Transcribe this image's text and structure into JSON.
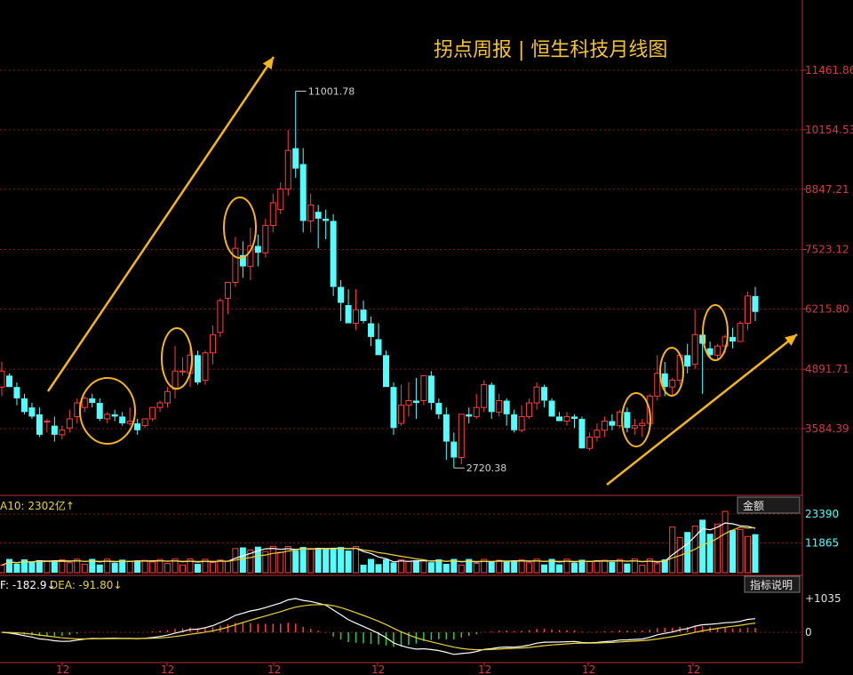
{
  "title": "拐点周报 | 恒生科技月线图",
  "chart_data": {
    "type": "candlestick",
    "y_ticks": [
      "11461.86",
      "10154.53",
      "8847.21",
      "7523.12",
      "6215.80",
      "4891.71",
      "3584.39"
    ],
    "x_ticks": [
      "12",
      "12",
      "12",
      "12",
      "12",
      "12",
      "12"
    ],
    "max_label": "11001.78",
    "min_label": "2720.38",
    "ohlc": [
      [
        4500,
        5050,
        4300,
        4850
      ],
      [
        4750,
        4800,
        4500,
        4500
      ],
      [
        4500,
        4600,
        4100,
        4250
      ],
      [
        4250,
        4350,
        3900,
        3950
      ],
      [
        4050,
        4150,
        3800,
        3850
      ],
      [
        3900,
        4050,
        3400,
        3450
      ],
      [
        3750,
        3800,
        3500,
        3750
      ],
      [
        3650,
        3850,
        3300,
        3450
      ],
      [
        3450,
        3650,
        3350,
        3550
      ],
      [
        3600,
        4000,
        3500,
        3800
      ],
      [
        3850,
        4250,
        3700,
        4150
      ],
      [
        4050,
        4300,
        3950,
        4250
      ],
      [
        4250,
        4350,
        4050,
        4150
      ],
      [
        4150,
        4250,
        3750,
        3800
      ],
      [
        3800,
        3950,
        3700,
        3900
      ],
      [
        3900,
        4000,
        3750,
        3850
      ],
      [
        3850,
        3950,
        3650,
        3700
      ],
      [
        3700,
        4050,
        3650,
        3750
      ],
      [
        3700,
        3800,
        3450,
        3550
      ],
      [
        3650,
        3800,
        3600,
        3800
      ],
      [
        3800,
        4050,
        3750,
        4050
      ],
      [
        4050,
        4200,
        3950,
        4150
      ],
      [
        4150,
        4500,
        4050,
        4400
      ],
      [
        4450,
        5400,
        4250,
        4850
      ],
      [
        4850,
        5150,
        4750,
        4850
      ],
      [
        4800,
        5400,
        4500,
        5200
      ],
      [
        5200,
        5300,
        4550,
        4600
      ],
      [
        4650,
        5300,
        4550,
        5250
      ],
      [
        5250,
        5850,
        5000,
        5650
      ],
      [
        5700,
        6450,
        5600,
        6400
      ],
      [
        6450,
        6750,
        6100,
        6800
      ],
      [
        6800,
        7800,
        6700,
        7550
      ],
      [
        7400,
        7700,
        6900,
        7150
      ],
      [
        7150,
        8000,
        6850,
        7600
      ],
      [
        7600,
        7850,
        7150,
        7450
      ],
      [
        7450,
        8200,
        7350,
        8050
      ],
      [
        8050,
        8750,
        7900,
        8550
      ],
      [
        8400,
        9000,
        8300,
        8850
      ],
      [
        8850,
        10150,
        8700,
        9700
      ],
      [
        9750,
        11001.78,
        9100,
        9300
      ],
      [
        9400,
        9750,
        7900,
        8150
      ],
      [
        8150,
        8750,
        7900,
        8500
      ],
      [
        8350,
        8500,
        7550,
        8200
      ],
      [
        8200,
        8400,
        7750,
        8150
      ],
      [
        8150,
        8300,
        6500,
        6700
      ],
      [
        6700,
        6850,
        5950,
        6350
      ],
      [
        6300,
        6650,
        5900,
        5900
      ],
      [
        5900,
        6650,
        5750,
        6200
      ],
      [
        6200,
        6400,
        5900,
        5950
      ],
      [
        5900,
        6050,
        5400,
        5600
      ],
      [
        5550,
        5900,
        5200,
        5200
      ],
      [
        5200,
        5300,
        4800,
        4500
      ],
      [
        4500,
        4600,
        3450,
        3600
      ],
      [
        3700,
        4550,
        3650,
        4100
      ],
      [
        4100,
        4600,
        3850,
        4200
      ],
      [
        4200,
        4700,
        3800,
        4150
      ],
      [
        4200,
        4750,
        4100,
        4750
      ],
      [
        4750,
        4850,
        4000,
        4150
      ],
      [
        4150,
        4250,
        3800,
        3900
      ],
      [
        3900,
        4050,
        2900,
        3300
      ],
      [
        3300,
        3500,
        2720.38,
        2950
      ],
      [
        2950,
        3900,
        2800,
        3900
      ],
      [
        3900,
        4050,
        3700,
        3850
      ],
      [
        3850,
        4350,
        3800,
        4050
      ],
      [
        4050,
        4650,
        3950,
        4550
      ],
      [
        4550,
        4600,
        3800,
        3950
      ],
      [
        3950,
        4350,
        3850,
        4200
      ],
      [
        4200,
        4250,
        3650,
        3900
      ],
      [
        3900,
        4000,
        3500,
        3550
      ],
      [
        3550,
        4100,
        3500,
        3850
      ],
      [
        3850,
        4250,
        3800,
        4150
      ],
      [
        4150,
        4600,
        4000,
        4500
      ],
      [
        4500,
        4550,
        4050,
        4200
      ],
      [
        4200,
        4250,
        3850,
        3850
      ],
      [
        3850,
        3950,
        3750,
        3750
      ],
      [
        3750,
        3950,
        3650,
        3850
      ],
      [
        3850,
        3900,
        3600,
        3800
      ],
      [
        3800,
        3850,
        3150,
        3150
      ],
      [
        3150,
        3500,
        3100,
        3400
      ],
      [
        3400,
        3700,
        3300,
        3550
      ],
      [
        3550,
        3850,
        3400,
        3750
      ],
      [
        3750,
        3900,
        3550,
        3650
      ],
      [
        3650,
        4000,
        3600,
        3950
      ],
      [
        3950,
        4050,
        3500,
        3600
      ],
      [
        3600,
        3800,
        3450,
        3650
      ],
      [
        3650,
        3800,
        3400,
        3700
      ],
      [
        3700,
        4350,
        3650,
        4300
      ],
      [
        4300,
        5200,
        4200,
        4800
      ],
      [
        4800,
        5050,
        4300,
        4500
      ],
      [
        4500,
        4700,
        4300,
        4650
      ],
      [
        4650,
        5250,
        4550,
        5200
      ],
      [
        5200,
        5450,
        4800,
        4950
      ],
      [
        5000,
        6200,
        4900,
        5650
      ],
      [
        5650,
        5700,
        4350,
        5450
      ],
      [
        5350,
        5500,
        5150,
        5200
      ],
      [
        5200,
        5450,
        5100,
        5400
      ],
      [
        5400,
        5650,
        5250,
        5600
      ],
      [
        5600,
        5800,
        5350,
        5500
      ],
      [
        5500,
        5950,
        5500,
        5900
      ],
      [
        5900,
        6600,
        5750,
        6500
      ],
      [
        6500,
        6700,
        5950,
        6150
      ]
    ],
    "volume_panel": {
      "ma_label": "A10: 2302亿↑",
      "y_ticks": [
        "23390",
        "11865"
      ],
      "button": "金额"
    },
    "macd_panel": {
      "dif_label": "F: -182.9↓",
      "dea_label": "DEA: -91.80↓",
      "y_ticks": [
        "+1035",
        "0"
      ],
      "button": "指标说明"
    },
    "colors": {
      "up": "#ff4040",
      "down": "#54ffff",
      "ma_white": "#ffffff",
      "ma_yellow": "#e8d43a",
      "annotation": "#f5b51c"
    }
  }
}
